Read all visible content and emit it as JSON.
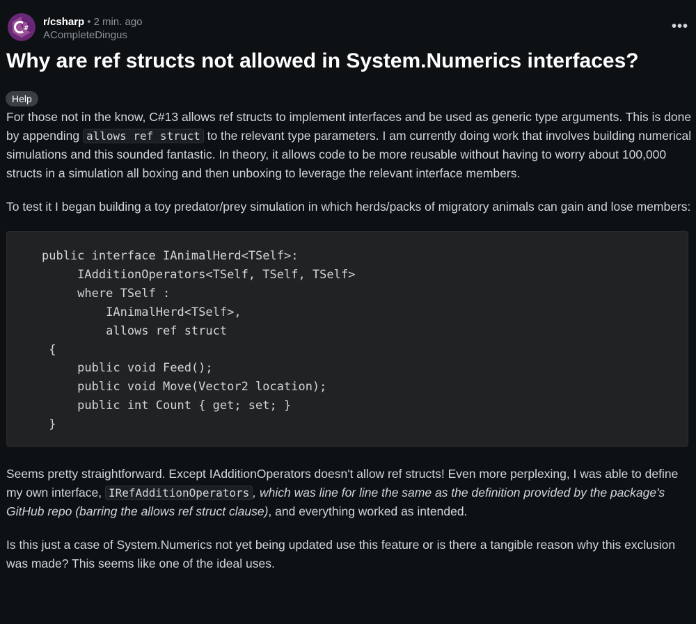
{
  "post": {
    "subreddit": "r/csharp",
    "separator": "•",
    "time": "2 min. ago",
    "author": "ACompleteDingus",
    "more_label": "•••",
    "title": "Why are ref structs not allowed in System.Numerics interfaces?",
    "flair": "Help"
  },
  "body": {
    "p1_a": "For those not in the know, C#13 allows ref structs to implement interfaces and be used as generic type arguments. This is done by appending ",
    "p1_code": "allows ref struct",
    "p1_b": " to the relevant type parameters. I am currently doing work that involves building numerical simulations and this sounded fantastic. In theory, it allows code to be more reusable without having to worry about 100,000 structs in a simulation all boxing and then unboxing to leverage the relevant interface members.",
    "p2": "To test it I began building a toy predator/prey simulation in which herds/packs of migratory animals can gain and lose members:",
    "code": "public interface IAnimalHerd<TSelf>:\n     IAdditionOperators<TSelf, TSelf, TSelf>\n     where TSelf :\n         IAnimalHerd<TSelf>,\n         allows ref struct\n {\n     public void Feed();\n     public void Move(Vector2 location);\n     public int Count { get; set; }\n }",
    "p3_a": "Seems pretty straightforward. Except IAdditionOperators doesn't allow ref structs! Even more perplexing, I was able to define my own interface, ",
    "p3_code": "IRefAdditionOperators",
    "p3_em": ", which was line for line the same as the definition provided by the package's GitHub repo (barring the allows ref struct clause)",
    "p3_b": ", and everything worked as intended.",
    "p4": "Is this just a case of System.Numerics not yet being updated use this feature or is there a tangible reason why this exclusion was made? This seems like one of the ideal uses."
  },
  "colors": {
    "background": "#0e1113",
    "avatar": "#682876",
    "flair": "#3a3f43"
  },
  "icons": {
    "avatar": "csharp-logo-icon"
  }
}
